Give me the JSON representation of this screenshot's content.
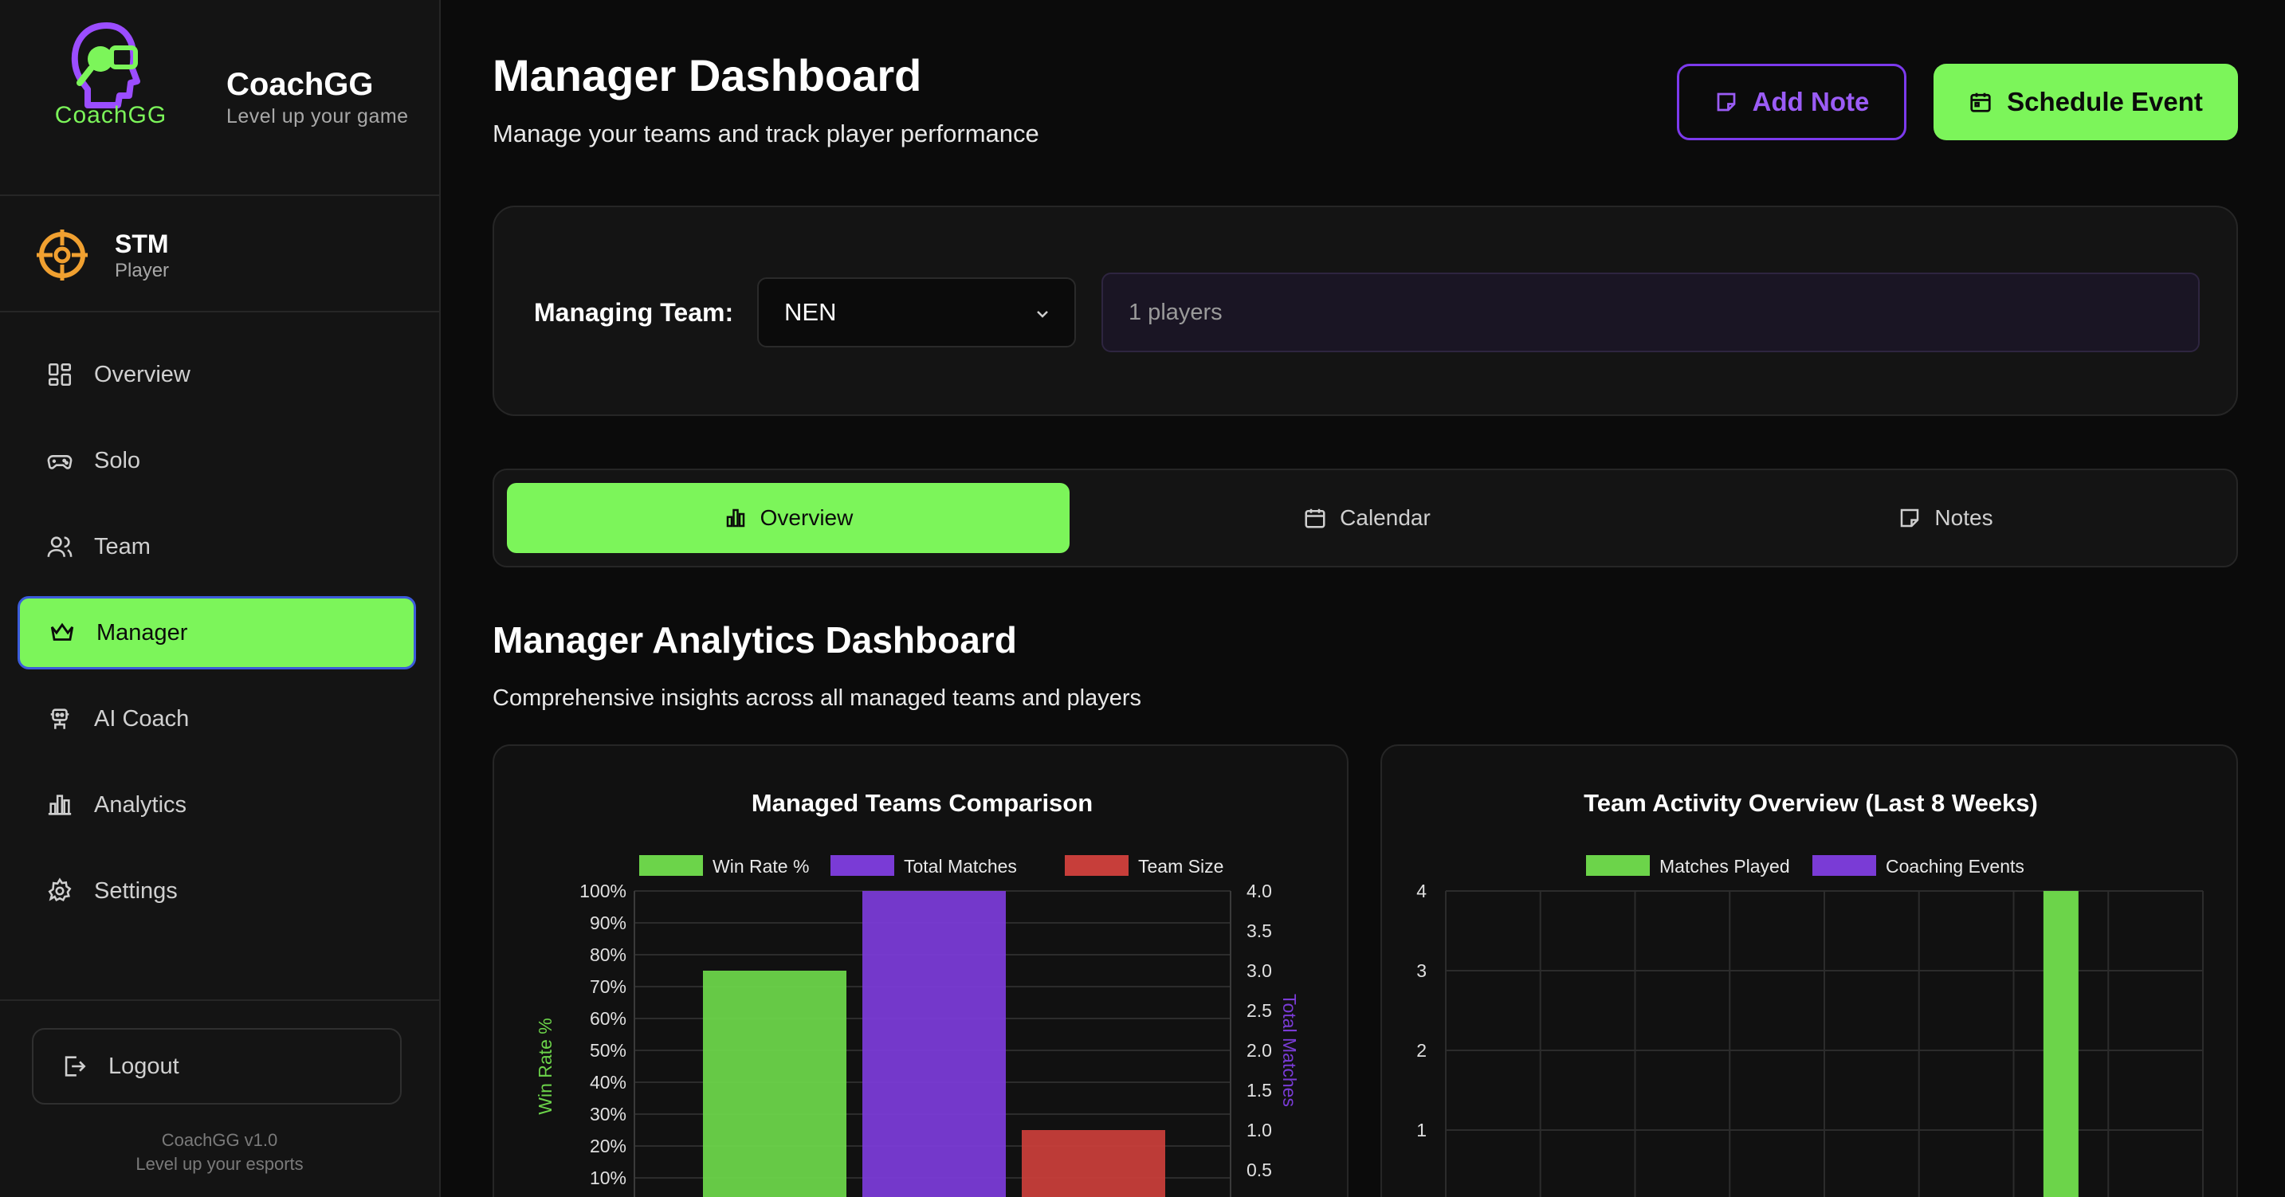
{
  "brand": {
    "logo_word": "CoachGG",
    "name": "CoachGG",
    "tagline": "Level up your game"
  },
  "user": {
    "name": "STM",
    "role": "Player"
  },
  "nav": [
    {
      "label": "Overview",
      "icon": "dashboard-grid-icon"
    },
    {
      "label": "Solo",
      "icon": "gamepad-icon"
    },
    {
      "label": "Team",
      "icon": "users-icon"
    },
    {
      "label": "Manager",
      "icon": "crown-icon",
      "active": true
    },
    {
      "label": "AI Coach",
      "icon": "robot-icon"
    },
    {
      "label": "Analytics",
      "icon": "bar-chart-icon"
    },
    {
      "label": "Settings",
      "icon": "gear-icon"
    }
  ],
  "logout_label": "Logout",
  "version": {
    "line1": "CoachGG v1.0",
    "line2": "Level up your esports"
  },
  "header": {
    "title": "Manager Dashboard",
    "subtitle": "Manage your teams and track player performance",
    "add_note": "Add Note",
    "schedule_event": "Schedule Event"
  },
  "team_picker": {
    "label": "Managing Team:",
    "selected": "NEN",
    "players": "1 players"
  },
  "tabs": [
    {
      "label": "Overview",
      "icon": "bar-chart-icon",
      "active": true
    },
    {
      "label": "Calendar",
      "icon": "calendar-icon"
    },
    {
      "label": "Notes",
      "icon": "note-icon"
    }
  ],
  "analytics": {
    "title": "Manager Analytics Dashboard",
    "subtitle": "Comprehensive insights across all managed teams and players"
  },
  "colors": {
    "accent": "#7cf55a",
    "purple": "#7c3aed",
    "red": "#c73e3a",
    "bg": "#0b0b0b",
    "panel": "#141414"
  },
  "chart_data": [
    {
      "type": "bar",
      "title": "Managed Teams Comparison",
      "series": [
        {
          "name": "Win Rate %",
          "values": [
            75
          ],
          "axis": "left",
          "color": "#6cd44a"
        },
        {
          "name": "Total Matches",
          "values": [
            4
          ],
          "axis": "right",
          "color": "#7a3bd6"
        },
        {
          "name": "Team Size",
          "values": [
            1
          ],
          "axis": "right",
          "color": "#c73e3a"
        }
      ],
      "y_left": {
        "label": "Win Rate %",
        "ticks": [
          "100%",
          "90%",
          "80%",
          "70%",
          "60%",
          "50%",
          "40%",
          "30%",
          "20%",
          "10%"
        ],
        "range": [
          0,
          100
        ]
      },
      "y_right": {
        "label": "Total Matches",
        "ticks": [
          "4.0",
          "3.5",
          "3.0",
          "2.5",
          "2.0",
          "1.5",
          "1.0",
          "0.5"
        ],
        "range": [
          0,
          4
        ]
      },
      "legend": "top",
      "grid": true
    },
    {
      "type": "bar",
      "title": "Team Activity Overview (Last 8 Weeks)",
      "series": [
        {
          "name": "Matches Played",
          "values": [
            0,
            0,
            0,
            0,
            0,
            0,
            4,
            0
          ],
          "color": "#6cd44a"
        },
        {
          "name": "Coaching Events",
          "values": [
            0,
            0,
            0,
            0,
            0,
            0,
            0,
            0
          ],
          "color": "#7a3bd6"
        }
      ],
      "y": {
        "ticks": [
          "4",
          "3",
          "2",
          "1"
        ],
        "range": [
          0,
          4
        ]
      },
      "legend": "top",
      "grid": true
    }
  ]
}
